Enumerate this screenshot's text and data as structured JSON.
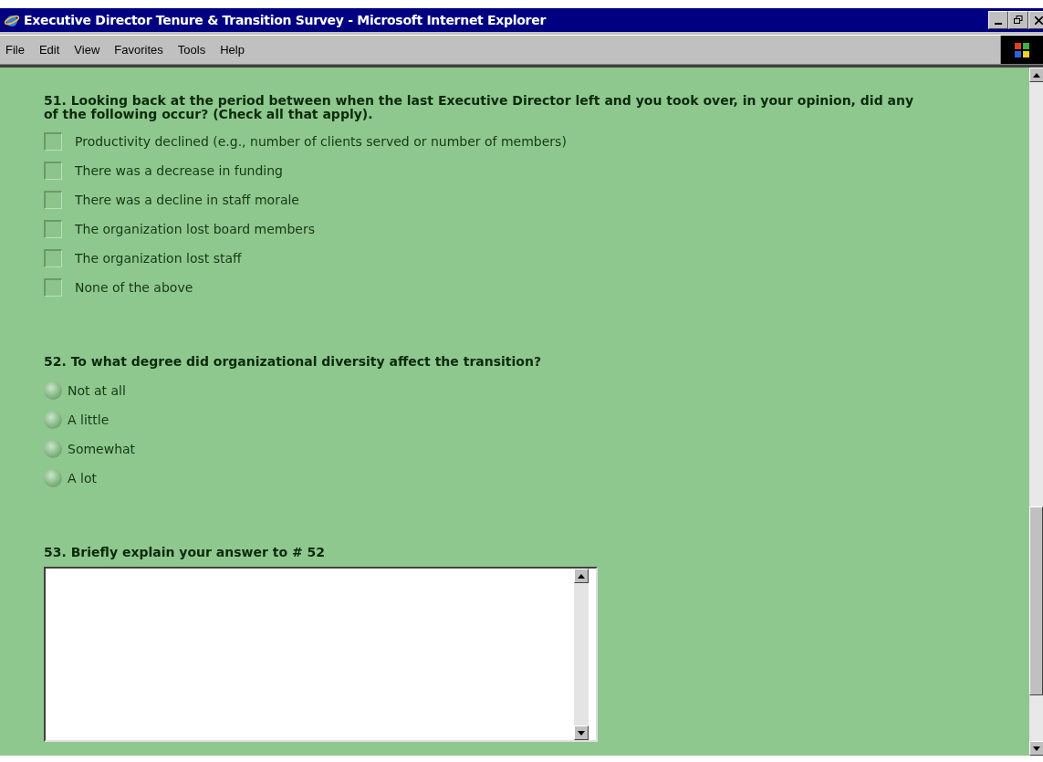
{
  "window": {
    "title": "Executive Director Tenure & Transition Survey - Microsoft Internet Explorer"
  },
  "menu": [
    "File",
    "Edit",
    "View",
    "Favorites",
    "Tools",
    "Help"
  ],
  "questions": [
    {
      "kind": "checkbox",
      "prompt": "51. Looking back at the period between when the last Executive Director left and you took over, in your opinion, did any of the following occur? (Check all that apply).",
      "options": [
        {
          "label": "Productivity declined (e.g., number of clients served or number of members)",
          "checked": false
        },
        {
          "label": "There was a decrease in funding",
          "checked": false
        },
        {
          "label": "There was a decline in staff morale",
          "checked": false
        },
        {
          "label": "The organization lost board members",
          "checked": false
        },
        {
          "label": "The organization lost staff",
          "checked": false
        },
        {
          "label": "None of the above",
          "checked": false
        }
      ]
    },
    {
      "kind": "radio",
      "prompt": "52. To what degree did organizational diversity affect the transition?",
      "options": [
        {
          "label": "Not at all",
          "selected": false
        },
        {
          "label": "A little",
          "selected": false
        },
        {
          "label": "Somewhat",
          "selected": false
        },
        {
          "label": "A lot",
          "selected": false
        }
      ]
    },
    {
      "kind": "text",
      "prompt": "53. Briefly explain your answer to # 52"
    }
  ]
}
